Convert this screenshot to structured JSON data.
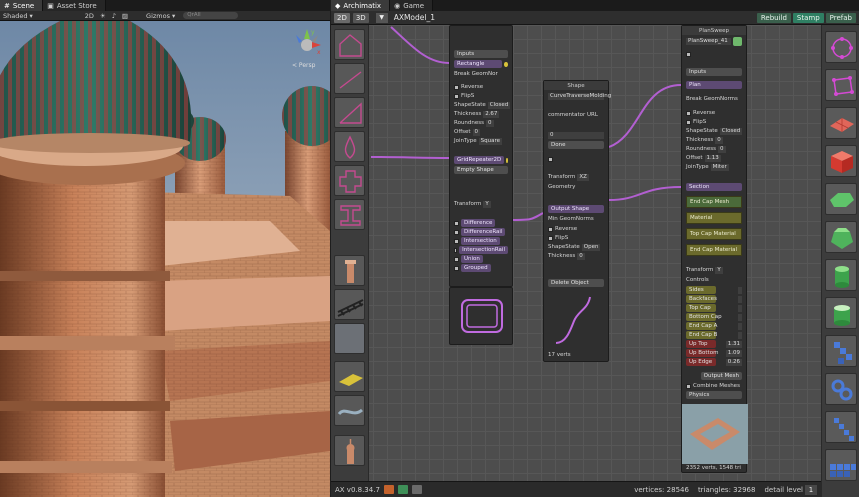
{
  "scene_tabs": [
    {
      "label": "Scene",
      "icon": "scene-icon"
    },
    {
      "label": "Asset Store",
      "icon": "store-icon"
    }
  ],
  "scene_toolbar": {
    "shading": "Shaded",
    "mode_2d": "2D",
    "gizmos": "Gizmos",
    "search_placeholder": "QrAll",
    "persp_label": "< Persp"
  },
  "arch_tabs": [
    {
      "label": "Archimatix",
      "icon": "archimatix-icon"
    },
    {
      "label": "Game",
      "icon": "game-icon"
    }
  ],
  "arch_toolbar": {
    "btn_2d": "2D",
    "btn_3d": "3D",
    "model_name": "AXModel_1",
    "rebuild": "Rebuild",
    "stamp": "Stamp",
    "prefab": "Prefab"
  },
  "node_shapes": {
    "inputs_label": "Inputs",
    "rectangle": "Rectangle",
    "break_geom": "Break GeomNor",
    "reverse": "Reverse",
    "flip_s": "FlipS",
    "shape_state": "ShapeState",
    "shape_state_val": "Closed",
    "thickness": "Thickness",
    "thickness_val": "2.67",
    "roundness": "Roundness",
    "roundness_val": "0",
    "offset": "Offset",
    "offset_val": "0",
    "join_type": "JoinType",
    "join_type_val": "Square",
    "grid_repeater": "GridRepeater2D",
    "empty_shape": "Empty Shape",
    "transform": "Transform",
    "transform_val": "Y",
    "ops": [
      "Difference",
      "DifferenceRail",
      "Intersection",
      "IntersectionRail",
      "Union",
      "Grouped"
    ]
  },
  "node_shape": {
    "title": "Shape",
    "curve_name": "CurveTraverseMolding",
    "library_url": "commentator URL",
    "field_val": "0",
    "done": "Done",
    "transform": "Transform",
    "transform_val": "XZ",
    "geometry": "Geometry",
    "output_shape": "Output Shape",
    "min_geom_norms": "Min GeomNorms",
    "reverse": "Reverse",
    "flip_s": "FlipS",
    "shape_state": "ShapeState",
    "shape_state_val": "Open",
    "thickness": "Thickness",
    "thickness_val": "0",
    "delete_object": "Delete Object",
    "verts": "17 verts"
  },
  "node_plansweep": {
    "title": "PlanSweep",
    "name": "PlanSweep_41",
    "inputs_label": "Inputs",
    "plan": "Plan",
    "break_geom": "Break GeomNorms",
    "reverse": "Reverse",
    "flip_s": "FlipS",
    "shape_state": "ShapeState",
    "shape_state_val": "Closed",
    "thickness": "Thickness",
    "thickness_val": "0",
    "roundness": "Roundness",
    "roundness_val": "0",
    "offset": "Offset",
    "offset_val": "1.13",
    "join_type": "JoinType",
    "join_type_val": "Miter",
    "section": "Section",
    "end_cap_mesh": "End Cap Mesh",
    "material": "Material",
    "top_cap_material": "Top Cap Material",
    "end_cap_material": "End Cap Material",
    "transform": "Transform",
    "transform_val": "Y",
    "controls": "Controls",
    "control_rows": [
      {
        "label": "Sides",
        "value": ""
      },
      {
        "label": "Backfaces",
        "value": ""
      },
      {
        "label": "Top Cap",
        "value": ""
      },
      {
        "label": "Bottom Cap",
        "value": ""
      },
      {
        "label": "End Cap A",
        "value": ""
      },
      {
        "label": "End Cap B",
        "value": ""
      },
      {
        "label": "Up Top",
        "value": "1.31"
      },
      {
        "label": "Up Bottom",
        "value": "1.09"
      },
      {
        "label": "Up Edge",
        "value": "0.26"
      }
    ],
    "output_mesh": "Output Mesh",
    "combine_meshes": "Combine Meshes",
    "physics": "Physics",
    "footer": "2352 verts, 1548 tri"
  },
  "right_sidebar_icons": [
    "circle-nodes-icon",
    "polygon-nodes-icon",
    "grid-plane-icon",
    "red-cube-icon",
    "green-disc-icon",
    "green-prism-icon",
    "green-cylinder-icon",
    "green-cylinder-open-icon",
    "blue-spiral-icon",
    "blue-chain-icon",
    "blue-stack-icon",
    "blue-grid-icon"
  ],
  "left_sidebar_icons": [
    "pentagon-shape-icon",
    "line-shape-icon",
    "angle-shape-icon",
    "drop-shape-icon",
    "cross-shape-icon",
    "ibeam-shape-icon",
    "pillar-thumb-icon",
    "truss-thumb-icon",
    "fabric-thumb-icon",
    "plate-thumb-icon",
    "ribbon-thumb-icon",
    "finial-thumb-icon"
  ],
  "status": {
    "version": "AX v0.8.34.7",
    "vertices_label": "vertices:",
    "vertices": "28546",
    "triangles_label": "triangles:",
    "triangles": "32968",
    "detail_label": "detail level",
    "detail": "1"
  }
}
